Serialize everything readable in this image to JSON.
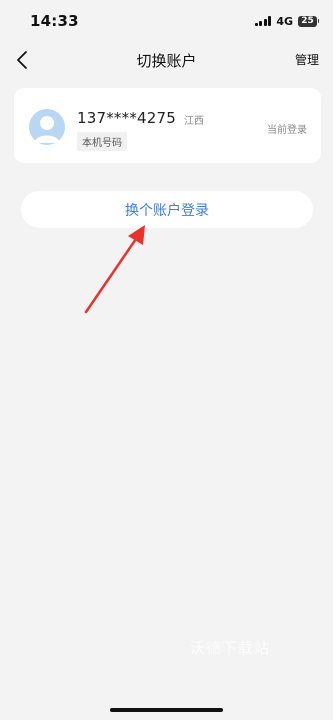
{
  "status_bar": {
    "time": "14:33",
    "network": "4G",
    "battery": "25"
  },
  "nav": {
    "title": "切换账户",
    "manage_label": "管理",
    "back_icon": "chevron-left-icon"
  },
  "account": {
    "phone": "137****4275",
    "region": "江西",
    "tag": "本机号码",
    "status": "当前登录",
    "avatar_color": "#b9d6f3"
  },
  "switch_button": {
    "label": "换个账户登录",
    "color": "#3b7fd9"
  },
  "annotation": {
    "arrow_color": "#e8322b"
  },
  "watermark": "沃德下载站"
}
